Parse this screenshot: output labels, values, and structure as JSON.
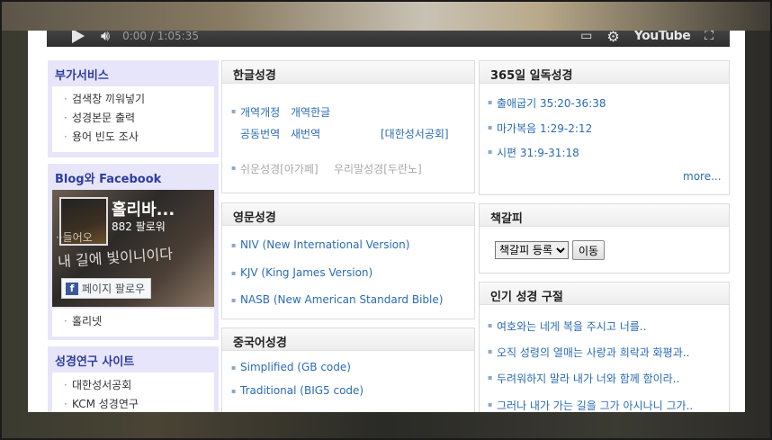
{
  "video": {
    "time": "0:00 / 1:05:35",
    "brand": "YouTube"
  },
  "left": {
    "services": {
      "title": "부가서비스",
      "items": [
        "검색창 끼워넣기",
        "성경본문 출력",
        "용어 빈도 조사"
      ]
    },
    "blog": {
      "title": "Blog와 Facebook",
      "fb_name": "홀리바...",
      "fb_followers": "882 팔로워",
      "fb_button": "페이지 팔로우",
      "script_line1": "··들어오",
      "script_line2": "내 길에 빛이니이다",
      "extra_item": "홀리넷"
    },
    "research": {
      "title": "성경연구 사이트",
      "items": [
        "대한성서공회",
        "KCM 성경연구"
      ]
    }
  },
  "korean": {
    "title": "한글성경",
    "links": [
      "개역개정",
      "개역한글",
      "공동번역",
      "새번역",
      "[대한성서공회]"
    ],
    "gray": [
      "쉬운성경[아가페]",
      "우리말성경[두란노]"
    ]
  },
  "english": {
    "title": "영문성경",
    "links": [
      "NIV (New International Version)",
      "KJV (King James Version)",
      "NASB (New American Standard Bible)"
    ]
  },
  "chinese": {
    "title": "중국어성경",
    "links": [
      "Simplified (GB code)",
      "Traditional (BIG5 code)"
    ]
  },
  "daily": {
    "title": "365일 일독성경",
    "links": [
      "출애굽기 35:20-36:38",
      "마가복음 1:29-2:12",
      "시편 31:9-31:18"
    ],
    "more": "more..."
  },
  "bookmark": {
    "title": "책갈피",
    "select": "책갈피 등록",
    "button": "이동"
  },
  "popular": {
    "title": "인기 성경 구절",
    "links": [
      "여호와는 네게 복을 주시고 너를..",
      "오직 성령의 열매는 사랑과 희락과 화평과..",
      "두려워하지 말라 내가 너와 함께 함이라..",
      "그러나 내가 가는 길을 그가 아시나니 그가.."
    ]
  }
}
